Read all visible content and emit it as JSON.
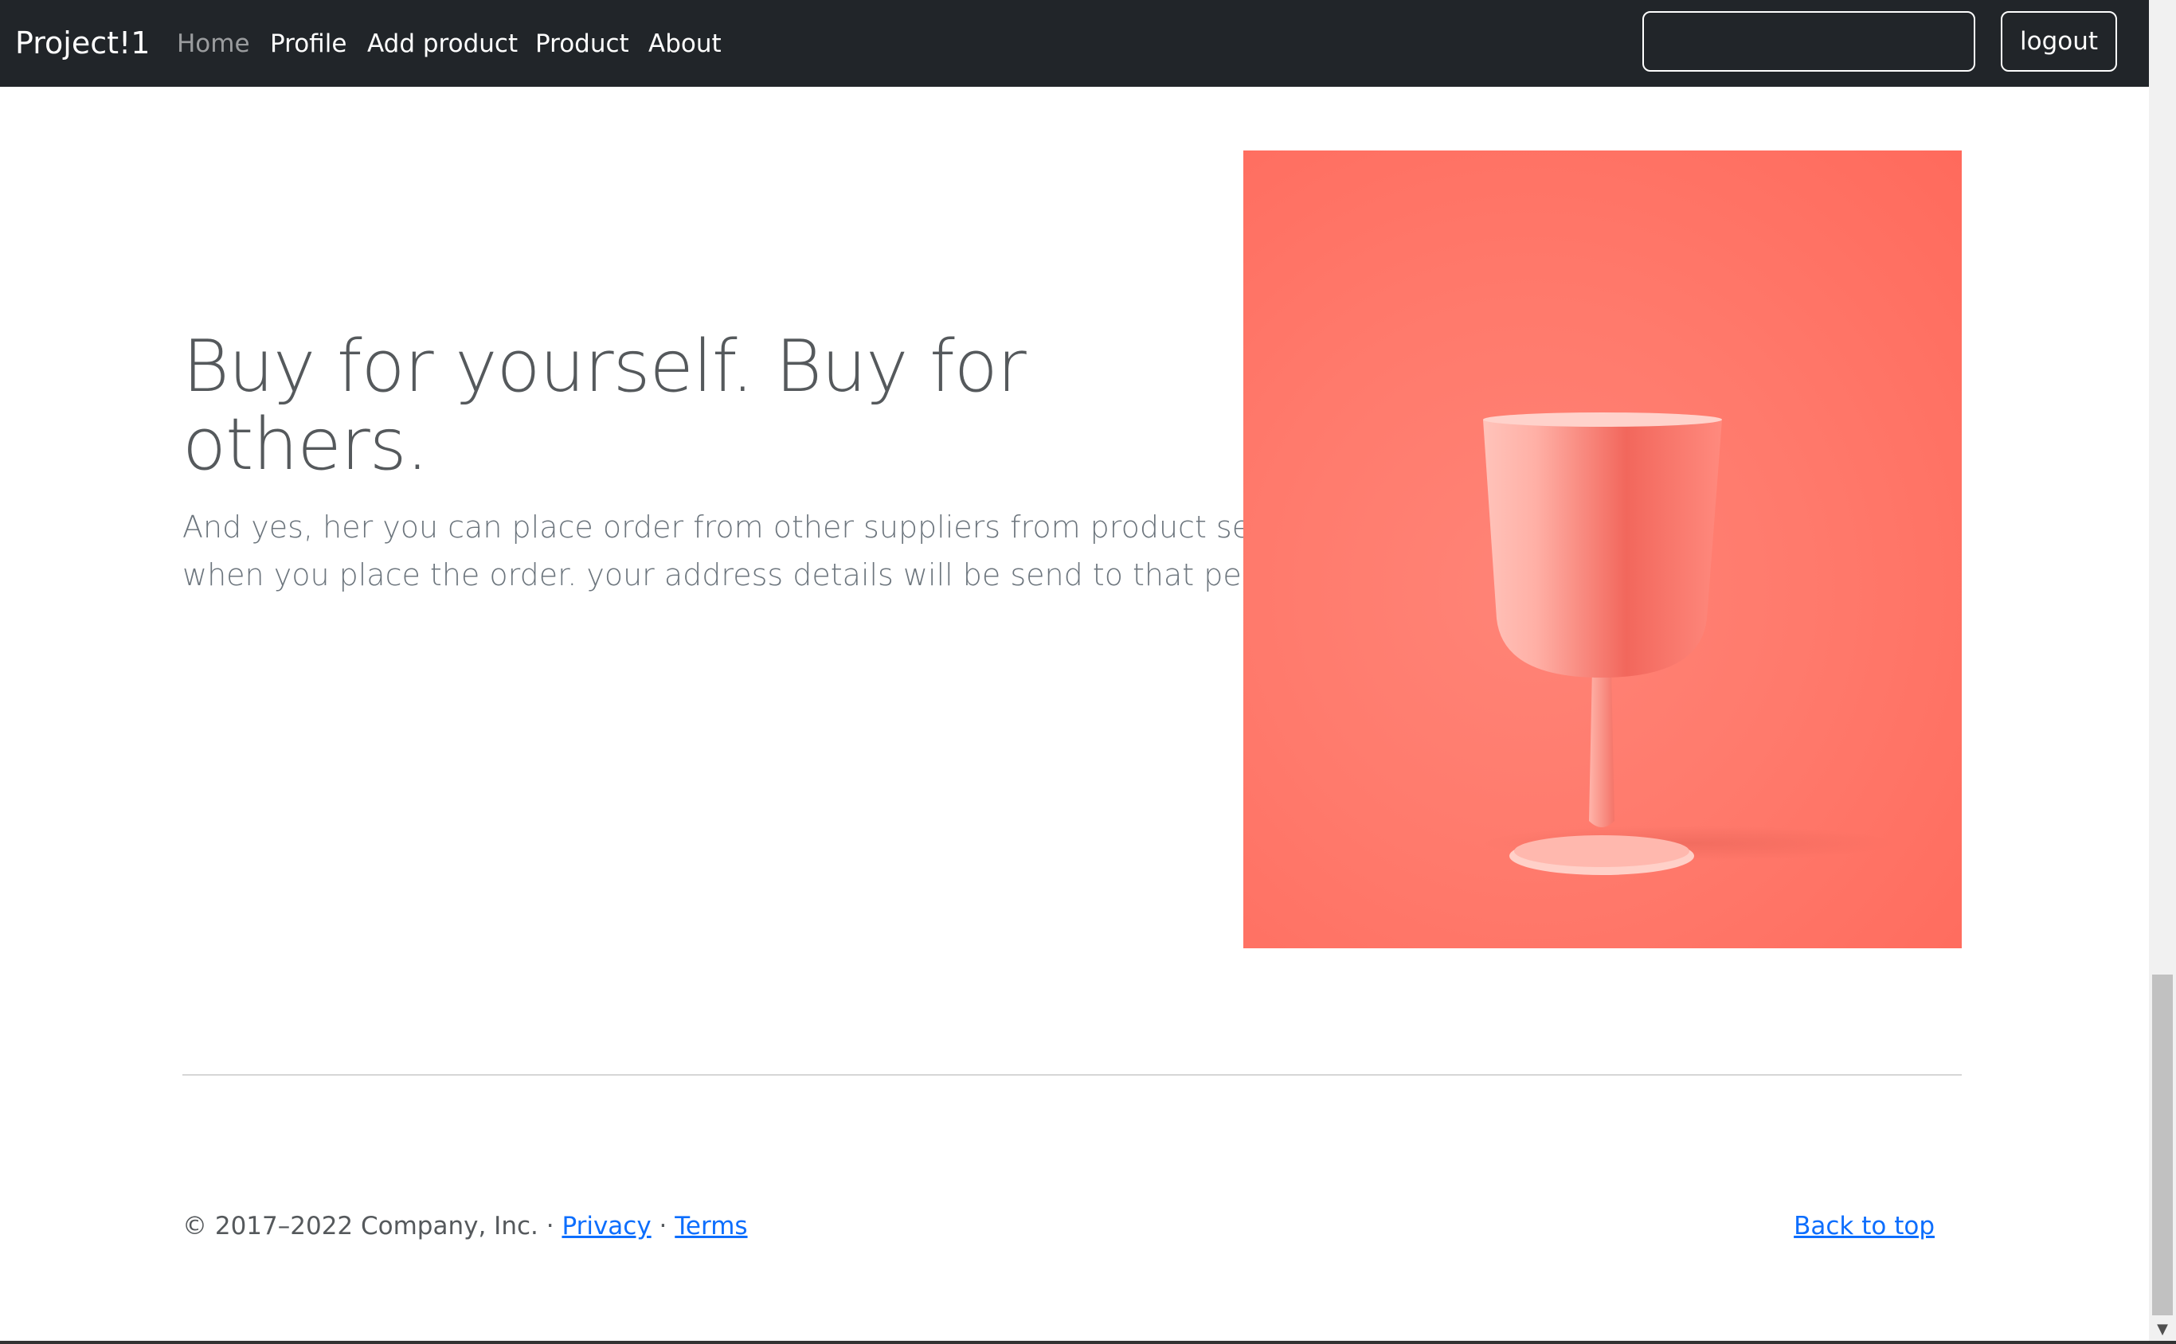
{
  "navbar": {
    "brand": "Project!1",
    "items": [
      {
        "label": "Home",
        "active": true
      },
      {
        "label": "Profile",
        "active": false
      },
      {
        "label": "Add product",
        "active": false
      },
      {
        "label": "Product",
        "active": false
      },
      {
        "label": "About",
        "active": false
      }
    ],
    "search": {
      "value": "",
      "placeholder": ""
    },
    "logout_label": "logout"
  },
  "feature": {
    "heading_line1": "Buy for yourself. Buy for",
    "heading_line2": "others.",
    "lead_line1": "And yes, her you can place order from other suppliers from product section.",
    "lead_line2": "when you place the order. your address details will be send to that person."
  },
  "footer": {
    "copyright": "© 2017–2022 Company, Inc. · ",
    "privacy": "Privacy",
    "separator": " · ",
    "terms": "Terms",
    "back_to_top": "Back to top"
  },
  "colors": {
    "navbar_bg": "#212529",
    "link": "#0d6efd",
    "image_bg": "#ff7a6c"
  }
}
